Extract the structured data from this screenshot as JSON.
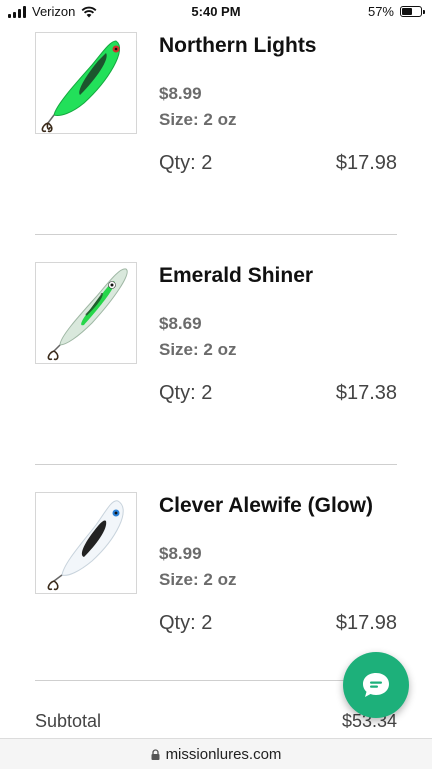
{
  "status_bar": {
    "carrier": "Verizon",
    "time": "5:40 PM",
    "battery": "57%",
    "battery_level": 0.57
  },
  "cart": {
    "items": [
      {
        "name": "Northern Lights",
        "price": "$8.99",
        "size": "Size: 2 oz",
        "qty": "Qty: 2",
        "total": "$17.98",
        "image_icon": "green-lure-northern-lights"
      },
      {
        "name": "Emerald Shiner",
        "price": "$8.69",
        "size": "Size: 2 oz",
        "qty": "Qty: 2",
        "total": "$17.38",
        "image_icon": "green-silver-lure-emerald-shiner"
      },
      {
        "name": "Clever Alewife (Glow)",
        "price": "$8.99",
        "size": "Size: 2 oz",
        "qty": "Qty: 2",
        "total": "$17.98",
        "image_icon": "white-glow-lure-alewife"
      }
    ],
    "subtotal_label": "Subtotal",
    "subtotal_value": "$53.34"
  },
  "chat": {
    "icon": "chat-bubble-icon",
    "color": "#1db07a"
  },
  "browser": {
    "url": "missionlures.com"
  }
}
